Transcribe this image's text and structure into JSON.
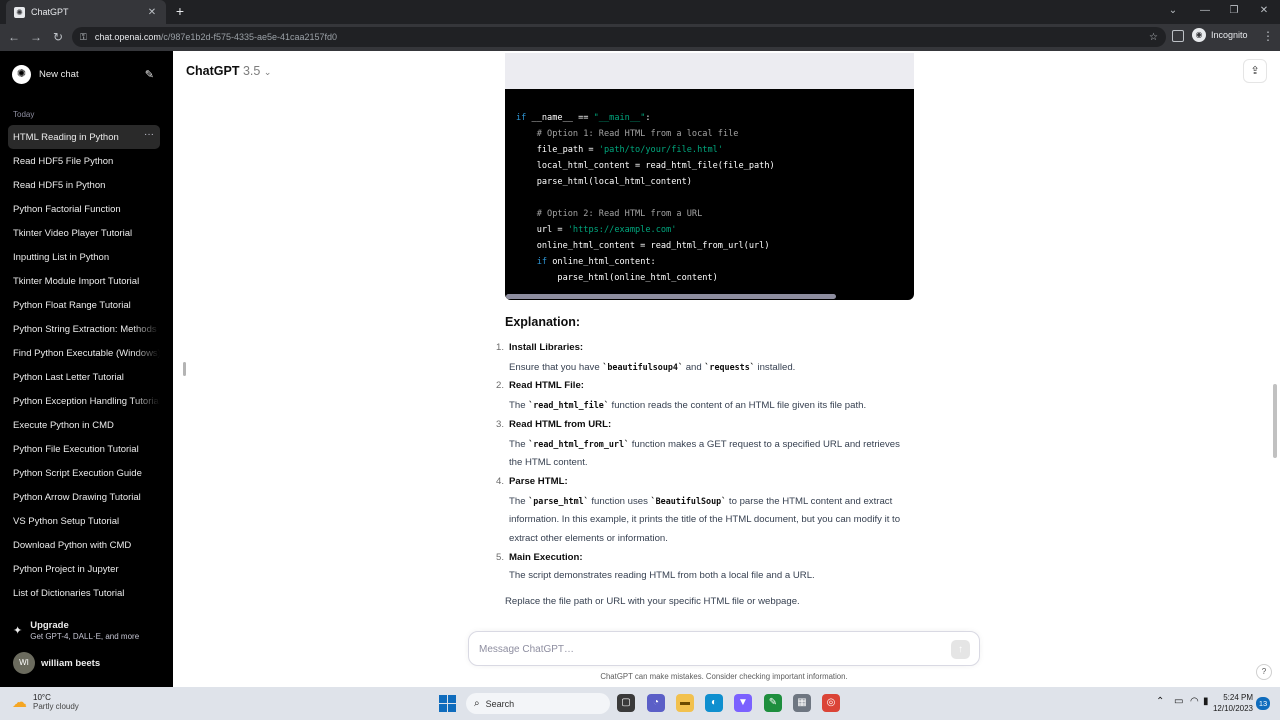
{
  "browser": {
    "tab_title": "ChatGPT",
    "tab_close": "✕",
    "new_tab": "+",
    "url_host": "chat.openai.com",
    "url_path": "/c/987e1b2d-f575-4335-ae5e-41caa2157fd0",
    "incognito_label": "Incognito",
    "window_controls": [
      "⌄",
      "—",
      "❐",
      "✕"
    ]
  },
  "sidebar": {
    "new_chat_label": "New chat",
    "section_label": "Today",
    "items": [
      {
        "label": "HTML Reading in Python",
        "active": true
      },
      {
        "label": "Read HDF5 File Python"
      },
      {
        "label": "Read HDF5 in Python"
      },
      {
        "label": "Python Factorial Function"
      },
      {
        "label": "Tkinter Video Player Tutorial"
      },
      {
        "label": "Inputting List in Python"
      },
      {
        "label": "Tkinter Module Import Tutorial"
      },
      {
        "label": "Python Float Range Tutorial"
      },
      {
        "label": "Python String Extraction: Methods"
      },
      {
        "label": "Find Python Executable (Windows)"
      },
      {
        "label": "Python Last Letter Tutorial"
      },
      {
        "label": "Python Exception Handling Tutorial"
      },
      {
        "label": "Execute Python in CMD"
      },
      {
        "label": "Python File Execution Tutorial"
      },
      {
        "label": "Python Script Execution Guide"
      },
      {
        "label": "Python Arrow Drawing Tutorial"
      },
      {
        "label": "VS Python Setup Tutorial"
      },
      {
        "label": "Download Python with CMD"
      },
      {
        "label": "Python Project in Jupyter"
      },
      {
        "label": "List of Dictionaries Tutorial"
      }
    ],
    "more_dots": "···",
    "upgrade_title": "Upgrade",
    "upgrade_subtitle": "Get GPT-4, DALL·E, and more",
    "user_initials": "WI",
    "user_name": "william beets"
  },
  "header": {
    "model_name": "ChatGPT",
    "model_version": "3.5"
  },
  "code_lines": [
    [
      {
        "t": "if",
        "c": "kw"
      },
      {
        "t": " __name__ == "
      },
      {
        "t": "\"__main__\"",
        "c": "str"
      },
      {
        "t": ":"
      }
    ],
    [
      {
        "t": "    "
      },
      {
        "t": "# Option 1: Read HTML from a local file",
        "c": "cm"
      }
    ],
    [
      {
        "t": "    file_path = "
      },
      {
        "t": "'path/to/your/file.html'",
        "c": "str"
      }
    ],
    [
      {
        "t": "    local_html_content = read_html_file(file_path)"
      }
    ],
    [
      {
        "t": "    parse_html(local_html_content)"
      }
    ],
    [
      {
        "t": ""
      }
    ],
    [
      {
        "t": "    "
      },
      {
        "t": "# Option 2: Read HTML from a URL",
        "c": "cm"
      }
    ],
    [
      {
        "t": "    url = "
      },
      {
        "t": "'https://example.com'",
        "c": "str"
      }
    ],
    [
      {
        "t": "    online_html_content = read_html_from_url(url)"
      }
    ],
    [
      {
        "t": "    "
      },
      {
        "t": "if",
        "c": "kw"
      },
      {
        "t": " online_html_content:"
      }
    ],
    [
      {
        "t": "        parse_html(online_html_content)"
      }
    ]
  ],
  "explanation": {
    "title": "Explanation:",
    "items": [
      {
        "num": "1.",
        "title": "Install Libraries:",
        "parts": [
          {
            "t": "Ensure that you have "
          },
          {
            "t": "`beautifulsoup4`",
            "code": true
          },
          {
            "t": " and "
          },
          {
            "t": "`requests`",
            "code": true
          },
          {
            "t": " installed."
          }
        ]
      },
      {
        "num": "2.",
        "title": "Read HTML File:",
        "parts": [
          {
            "t": "The "
          },
          {
            "t": "`read_html_file`",
            "code": true
          },
          {
            "t": " function reads the content of an HTML file given its file path."
          }
        ]
      },
      {
        "num": "3.",
        "title": "Read HTML from URL:",
        "parts": [
          {
            "t": "The "
          },
          {
            "t": "`read_html_from_url`",
            "code": true
          },
          {
            "t": " function makes a GET request to a specified URL and retrieves the HTML content."
          }
        ]
      },
      {
        "num": "4.",
        "title": "Parse HTML:",
        "parts": [
          {
            "t": "The "
          },
          {
            "t": "`parse_html`",
            "code": true
          },
          {
            "t": " function uses "
          },
          {
            "t": "`BeautifulSoup`",
            "code": true
          },
          {
            "t": " to parse the HTML content and extract information. In this example, it prints the title of the HTML document, but you can modify it to extract other elements or information."
          }
        ]
      },
      {
        "num": "5.",
        "title": "Main Execution:",
        "parts": [
          {
            "t": "The script demonstrates reading HTML from both a local file and a URL."
          }
        ]
      }
    ],
    "closing": "Replace the file path or URL with your specific HTML file or webpage."
  },
  "composer": {
    "placeholder": "Message ChatGPT…",
    "disclaimer": "ChatGPT can make mistakes. Consider checking important information.",
    "help": "?"
  },
  "taskbar": {
    "temperature": "10°C",
    "condition": "Partly cloudy",
    "search_label": "Search",
    "time": "5:24 PM",
    "date": "12/10/2023",
    "notification_count": "13"
  },
  "colors": {
    "sidebar_bg": "#000000",
    "code_bg": "#000000",
    "keyword": "#2e95d3",
    "string": "#00a67d",
    "comment": "#a3a3a3",
    "taskbar_accent": "#0f6cbd"
  }
}
